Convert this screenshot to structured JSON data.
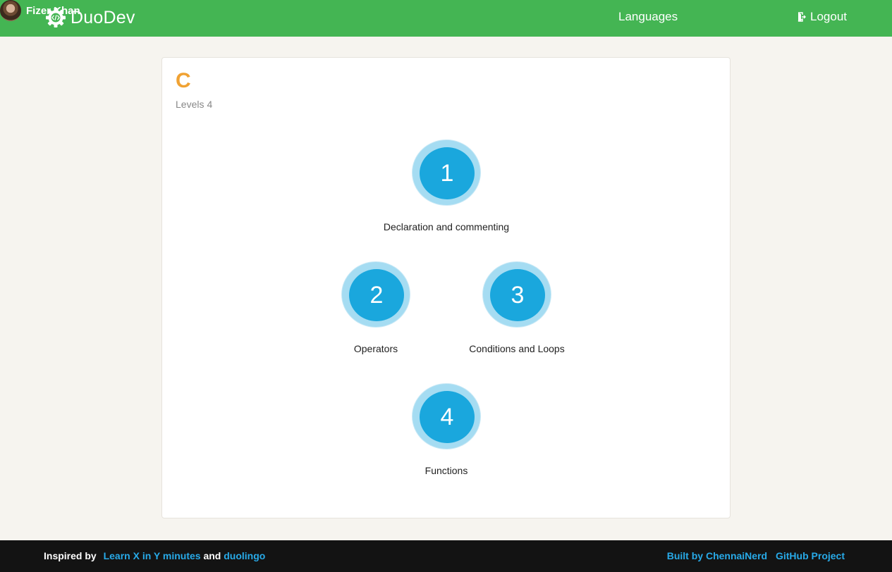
{
  "header": {
    "brand": "DuoDev",
    "nav_languages": "Languages",
    "user_name": "Fizer Khan",
    "logout": "Logout",
    "brand_color": "#44b553"
  },
  "card": {
    "title": "C",
    "levels_label": "Levels",
    "levels_count": "4",
    "title_color": "#f0a233"
  },
  "skills": [
    {
      "number": "1",
      "label": "Declaration and commenting"
    },
    {
      "number": "2",
      "label": "Operators"
    },
    {
      "number": "3",
      "label": "Conditions and Loops"
    },
    {
      "number": "4",
      "label": "Functions"
    }
  ],
  "skill_colors": {
    "inner": "#1aa7dd",
    "ring": "#a5dcf2"
  },
  "footer": {
    "inspired_by": "Inspired by",
    "learn_link": "Learn X in Y minutes",
    "and": "and",
    "duolingo_link": "duolingo",
    "built_by": "Built by ChennaiNerd",
    "github_link": "GitHub Project",
    "link_color": "#28aae8"
  },
  "icons": {
    "brand": "gear-code-icon",
    "avatar": "user-avatar",
    "logout": "logout-icon"
  }
}
